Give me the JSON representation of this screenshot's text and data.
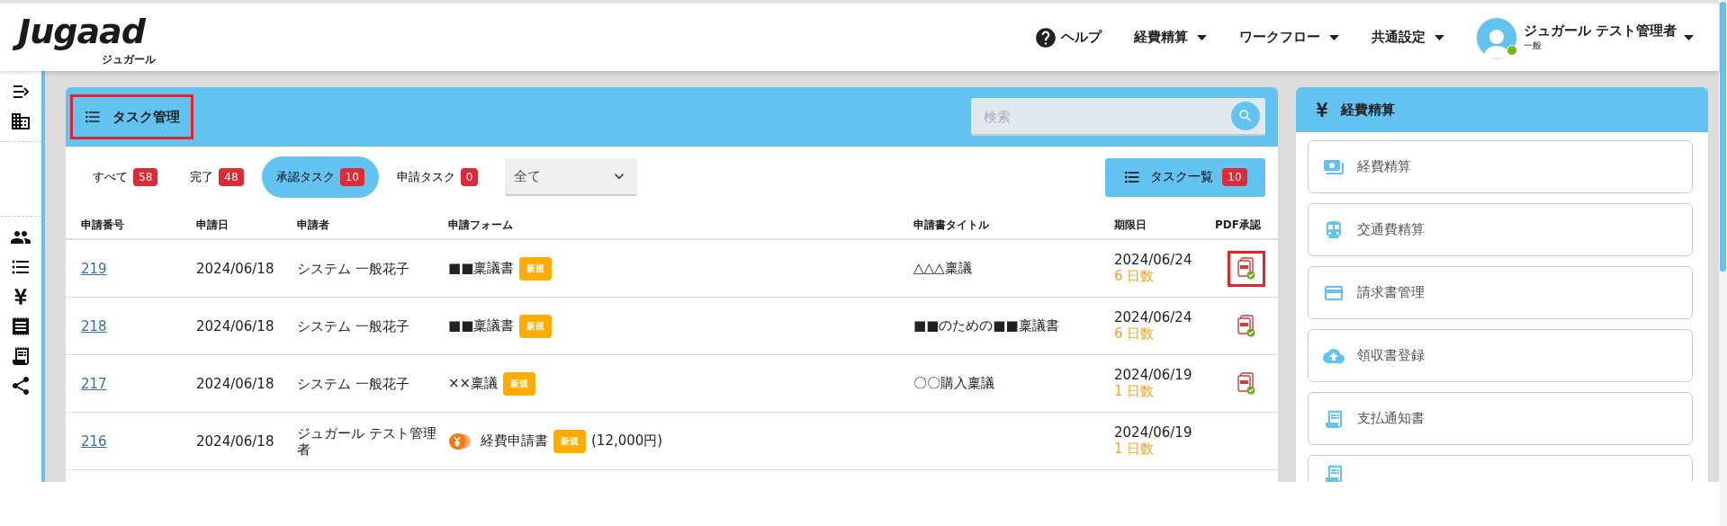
{
  "header": {
    "logo": "Jugaad",
    "logo_sub": "ジュガール",
    "nav": [
      {
        "label": "ヘルプ",
        "kind": "help"
      },
      {
        "label": "経費精算",
        "kind": "menu"
      },
      {
        "label": "ワークフロー",
        "kind": "menu"
      },
      {
        "label": "共通設定",
        "kind": "menu"
      }
    ],
    "user": {
      "name": "ジュガール テスト管理者",
      "role": "一般",
      "online": true
    }
  },
  "task_panel": {
    "title": "タスク管理",
    "highlighted": true,
    "search": {
      "placeholder": "検索"
    },
    "tabs": [
      {
        "label": "すべて",
        "count": "58",
        "selected": false
      },
      {
        "label": "完了",
        "count": "48",
        "selected": false
      },
      {
        "label": "承認タスク",
        "count": "10",
        "selected": true
      },
      {
        "label": "申請タスク",
        "count": "0",
        "selected": false
      }
    ],
    "filter": {
      "value": "全て"
    },
    "list_button": {
      "label": "タスク一覧",
      "count": "10"
    },
    "table": {
      "columns": [
        "申請番号",
        "申請日",
        "申請者",
        "申請フォーム",
        "申請書タイトル",
        "期限日",
        "PDF承認"
      ],
      "rows": [
        {
          "number": "219",
          "date": "2024/06/18",
          "applicant": "システム 一般花子",
          "form": "■■稟議書",
          "kind": "approval",
          "badge": "新規",
          "title": "△△△稟議",
          "due_date": "2024/06/24",
          "remaining": "6 日数",
          "pdf": true,
          "highlighted": true
        },
        {
          "number": "218",
          "date": "2024/06/18",
          "applicant": "システム 一般花子",
          "form": "■■稟議書",
          "kind": "approval",
          "badge": "新規",
          "title": "■■のための■■稟議書",
          "due_date": "2024/06/24",
          "remaining": "6 日数",
          "pdf": true,
          "highlighted": false
        },
        {
          "number": "217",
          "date": "2024/06/18",
          "applicant": "システム 一般花子",
          "form": "××稟議",
          "kind": "approval",
          "badge": "新規",
          "title": "〇〇購入稟議",
          "due_date": "2024/06/19",
          "remaining": "1 日数",
          "pdf": true,
          "highlighted": false
        },
        {
          "number": "216",
          "date": "2024/06/18",
          "applicant": "ジュガール テスト管理者",
          "form": "経費申請書",
          "kind": "expense",
          "badge": "新規",
          "amount": "(12,000円)",
          "due_date": "2024/06/19",
          "remaining": "1 日数",
          "pdf": false
        }
      ]
    }
  },
  "expense_panel": {
    "title": "経費精算",
    "items": [
      {
        "label": "経費精算",
        "kind": "link"
      },
      {
        "label": "交通費精算",
        "kind": "link"
      },
      {
        "label": "請求書管理",
        "kind": "link"
      },
      {
        "label": "領収書登録",
        "kind": "link"
      },
      {
        "label": "支払通知書",
        "kind": "link"
      },
      {
        "kind": "cut"
      }
    ]
  }
}
